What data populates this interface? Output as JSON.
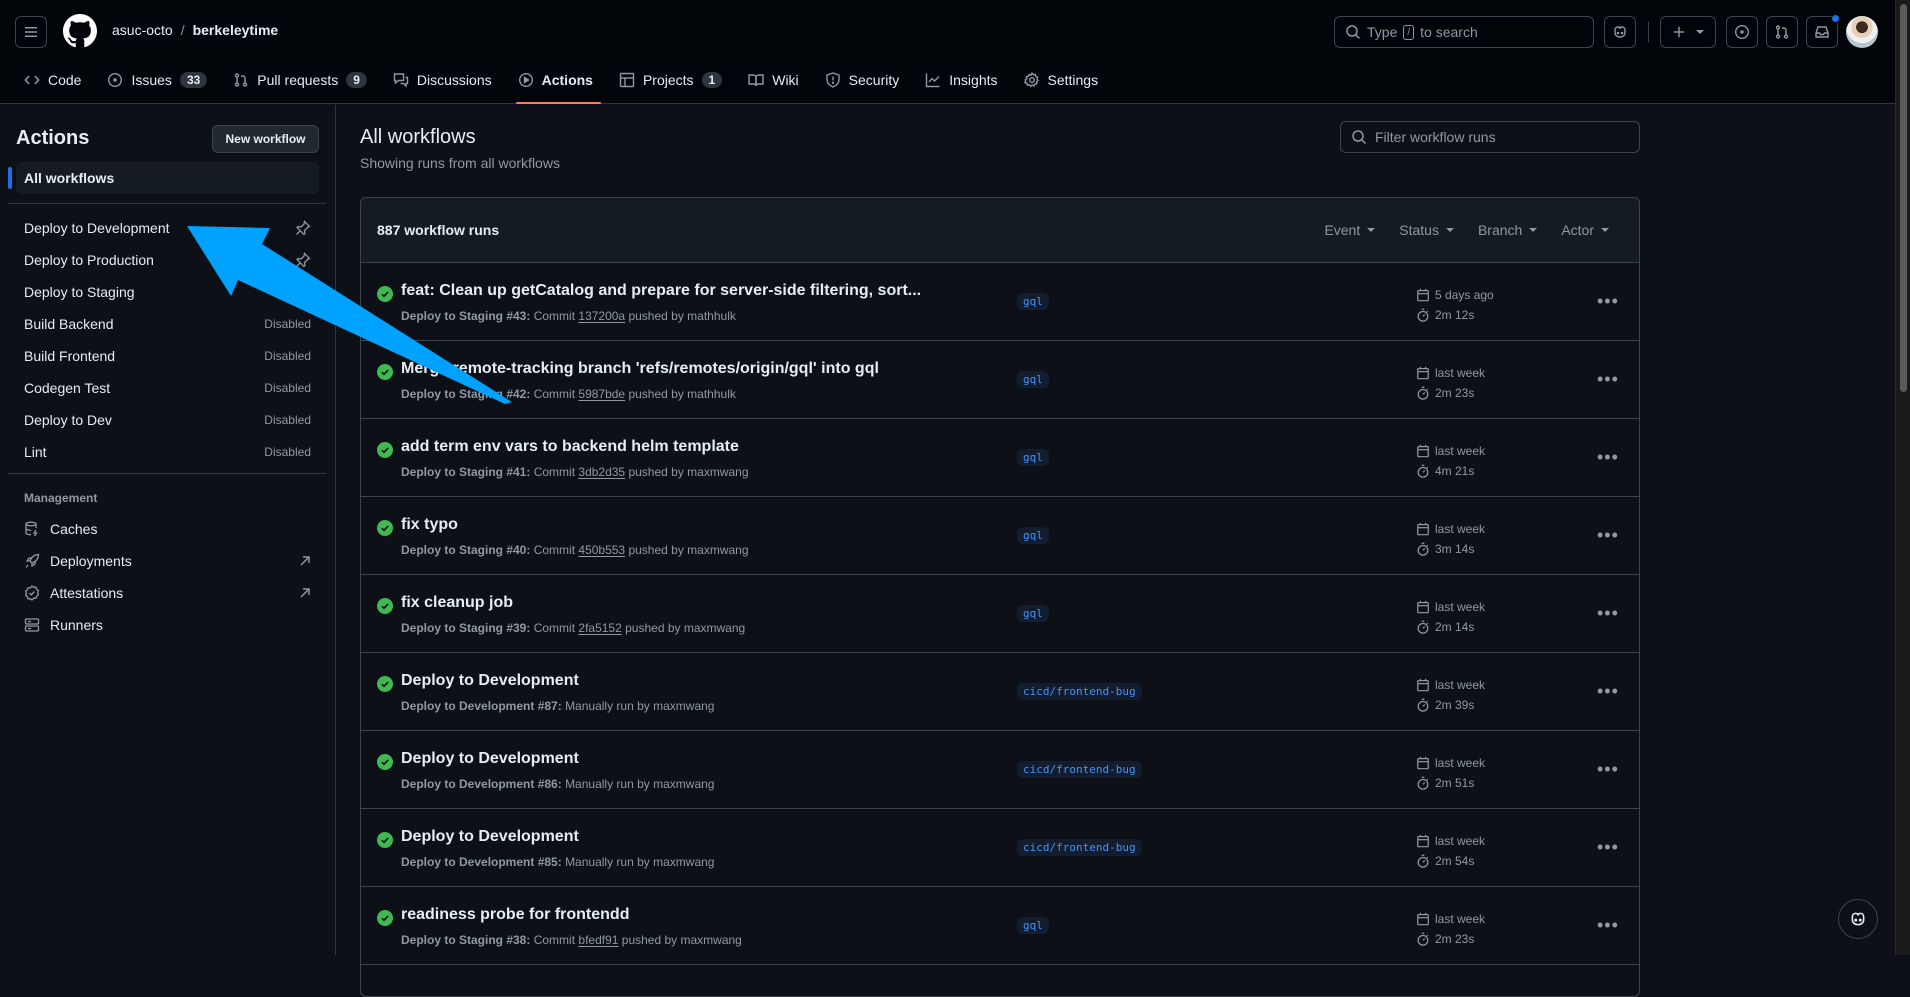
{
  "header": {
    "owner": "asuc-octo",
    "separator": "/",
    "repo": "berkeleytime",
    "search_placeholder_pre": "Type",
    "search_key": "/",
    "search_placeholder_post": "to search"
  },
  "repo_tabs": [
    {
      "label": "Code",
      "icon": "code-icon",
      "counter": null
    },
    {
      "label": "Issues",
      "icon": "issue-icon",
      "counter": "33"
    },
    {
      "label": "Pull requests",
      "icon": "pull-request-icon",
      "counter": "9"
    },
    {
      "label": "Discussions",
      "icon": "discussions-icon",
      "counter": null
    },
    {
      "label": "Actions",
      "icon": "play-icon",
      "counter": null,
      "active": true
    },
    {
      "label": "Projects",
      "icon": "table-icon",
      "counter": "1"
    },
    {
      "label": "Wiki",
      "icon": "book-icon",
      "counter": null
    },
    {
      "label": "Security",
      "icon": "shield-icon",
      "counter": null
    },
    {
      "label": "Insights",
      "icon": "graph-icon",
      "counter": null
    },
    {
      "label": "Settings",
      "icon": "gear-icon",
      "counter": null
    }
  ],
  "sidebar": {
    "title": "Actions",
    "new_workflow_label": "New workflow",
    "all_workflows_label": "All workflows",
    "workflows": [
      {
        "label": "Deploy to Development",
        "status": "",
        "pinned": true
      },
      {
        "label": "Deploy to Production",
        "status": "",
        "pinned": true
      },
      {
        "label": "Deploy to Staging",
        "status": "",
        "pinned": false
      },
      {
        "label": "Build Backend",
        "status": "Disabled",
        "pinned": false
      },
      {
        "label": "Build Frontend",
        "status": "Disabled",
        "pinned": false
      },
      {
        "label": "Codegen Test",
        "status": "Disabled",
        "pinned": false
      },
      {
        "label": "Deploy to Dev",
        "status": "Disabled",
        "pinned": false
      },
      {
        "label": "Lint",
        "status": "Disabled",
        "pinned": false
      }
    ],
    "management_label": "Management",
    "management": [
      {
        "label": "Caches",
        "icon": "database-icon",
        "external": false
      },
      {
        "label": "Deployments",
        "icon": "rocket-icon",
        "external": true
      },
      {
        "label": "Attestations",
        "icon": "verified-icon",
        "external": true
      },
      {
        "label": "Runners",
        "icon": "server-icon",
        "external": false
      }
    ]
  },
  "main": {
    "title": "All workflows",
    "subtitle": "Showing runs from all workflows",
    "filter_placeholder": "Filter workflow runs",
    "run_count": "887 workflow runs",
    "filters": [
      "Event",
      "Status",
      "Branch",
      "Actor"
    ],
    "runs": [
      {
        "title": "feat: Clean up getCatalog and prepare for server-side filtering, sort...",
        "workflow": "Deploy to Staging #43:",
        "pre": "Commit",
        "commit": "137200a",
        "post": "pushed by mathhulk",
        "branch": "gql",
        "when": "5 days ago",
        "duration": "2m 12s"
      },
      {
        "title": "Merge remote-tracking branch 'refs/remotes/origin/gql' into gql",
        "workflow": "Deploy to Staging #42:",
        "pre": "Commit",
        "commit": "5987bde",
        "post": "pushed by mathhulk",
        "branch": "gql",
        "when": "last week",
        "duration": "2m 23s"
      },
      {
        "title": "add term env vars to backend helm template",
        "workflow": "Deploy to Staging #41:",
        "pre": "Commit",
        "commit": "3db2d35",
        "post": "pushed by maxmwang",
        "branch": "gql",
        "when": "last week",
        "duration": "4m 21s"
      },
      {
        "title": "fix typo",
        "workflow": "Deploy to Staging #40:",
        "pre": "Commit",
        "commit": "450b553",
        "post": "pushed by maxmwang",
        "branch": "gql",
        "when": "last week",
        "duration": "3m 14s"
      },
      {
        "title": "fix cleanup job",
        "workflow": "Deploy to Staging #39:",
        "pre": "Commit",
        "commit": "2fa5152",
        "post": "pushed by maxmwang",
        "branch": "gql",
        "when": "last week",
        "duration": "2m 14s"
      },
      {
        "title": "Deploy to Development",
        "workflow": "Deploy to Development #87:",
        "pre": "Manually run by maxmwang",
        "commit": "",
        "post": "",
        "branch": "cicd/frontend-bug",
        "when": "last week",
        "duration": "2m 39s"
      },
      {
        "title": "Deploy to Development",
        "workflow": "Deploy to Development #86:",
        "pre": "Manually run by maxmwang",
        "commit": "",
        "post": "",
        "branch": "cicd/frontend-bug",
        "when": "last week",
        "duration": "2m 51s"
      },
      {
        "title": "Deploy to Development",
        "workflow": "Deploy to Development #85:",
        "pre": "Manually run by maxmwang",
        "commit": "",
        "post": "",
        "branch": "cicd/frontend-bug",
        "when": "last week",
        "duration": "2m 54s"
      },
      {
        "title": "readiness probe for frontendd",
        "workflow": "Deploy to Staging #38:",
        "pre": "Commit",
        "commit": "bfedf91",
        "post": "pushed by maxmwang",
        "branch": "gql",
        "when": "last week",
        "duration": "2m 23s"
      }
    ]
  },
  "colors": {
    "accent": "#1f6feb",
    "success": "#3fb950",
    "annotation_arrow": "#00a2ff",
    "active_tab_underline": "#f78166"
  }
}
